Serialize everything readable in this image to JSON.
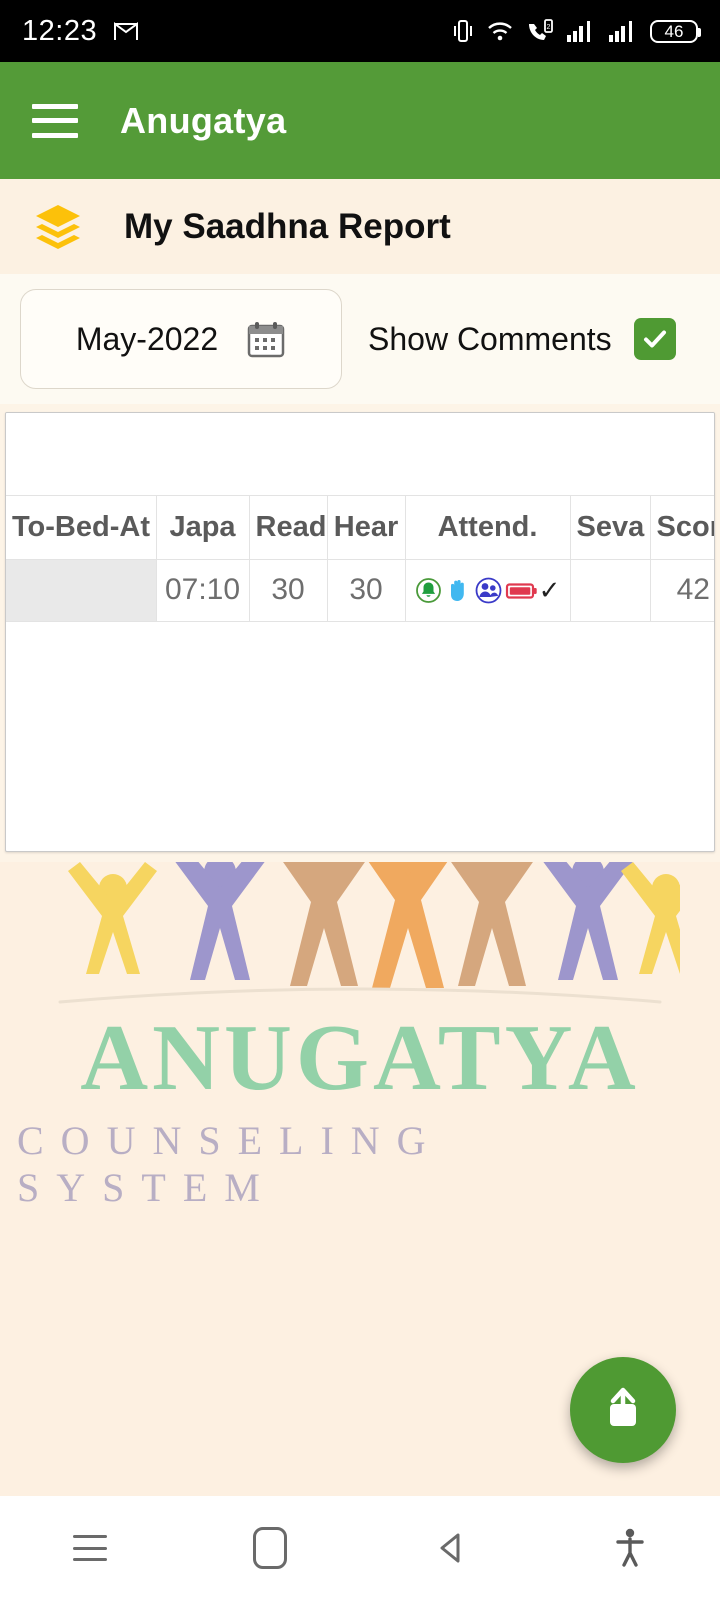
{
  "status_bar": {
    "time": "12:23",
    "app_icon": "gmail-icon",
    "icons": [
      "vibrate-icon",
      "wifi-icon",
      "call-wifi-icon",
      "signal-bars-sim1-icon",
      "signal-bars-sim2-icon"
    ],
    "battery_percent": "46"
  },
  "app_bar": {
    "menu_icon": "hamburger-menu-icon",
    "title": "Anugatya",
    "background_color": "#549b38"
  },
  "page": {
    "icon": "layers-stack-icon",
    "title": "My Saadhna Report",
    "background_color": "#fcf1e2"
  },
  "filters": {
    "month_value": "May-2022",
    "calendar_icon": "calendar-icon",
    "show_comments_label": "Show Comments",
    "show_comments_checked": true,
    "checkbox_color": "#4f9a33"
  },
  "report_table": {
    "columns": [
      "To-Bed-At",
      "Japa",
      "Read",
      "Hear",
      "Attend.",
      "Seva",
      "Score"
    ],
    "rows": [
      {
        "to_bed_at": "",
        "japa": "07:10",
        "read": "30",
        "hear": "30",
        "attend_icons": [
          "bell-icon",
          "raised-hand-icon",
          "people-group-icon",
          "battery-red-icon"
        ],
        "attend_check": "✓",
        "seva": "",
        "score": "42"
      }
    ]
  },
  "watermark": {
    "brand": "ANUGATYA",
    "tagline": "COUNSELING SYSTEM",
    "brand_color": "#93d1a8",
    "tagline_color": "#b8aec4"
  },
  "fab": {
    "icon": "share-upload-icon",
    "color": "#4f9a33"
  },
  "nav_bar": {
    "buttons": [
      "recents-icon",
      "home-icon",
      "back-icon",
      "accessibility-icon"
    ]
  }
}
